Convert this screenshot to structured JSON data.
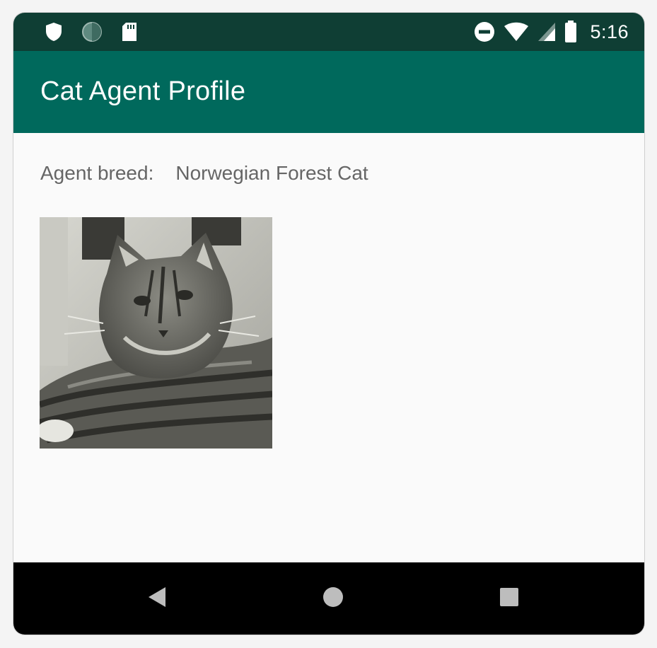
{
  "status_bar": {
    "time": "5:16",
    "left_icons": [
      "shield-icon",
      "sync-circle-icon",
      "sd-card-icon"
    ],
    "right_icons": [
      "do-not-disturb-icon",
      "wifi-icon",
      "cell-signal-icon",
      "battery-icon"
    ]
  },
  "app_bar": {
    "title": "Cat Agent Profile"
  },
  "profile": {
    "breed_label": "Agent breed:",
    "breed_value": "Norwegian Forest Cat",
    "photo_icon": "cat-photo"
  },
  "nav_bar": {
    "buttons": [
      "back-icon",
      "home-icon",
      "recents-icon"
    ]
  },
  "colors": {
    "status_bar": "#0f3e34",
    "app_bar": "#00695c",
    "background": "#fafafa",
    "nav_bar": "#000000"
  }
}
